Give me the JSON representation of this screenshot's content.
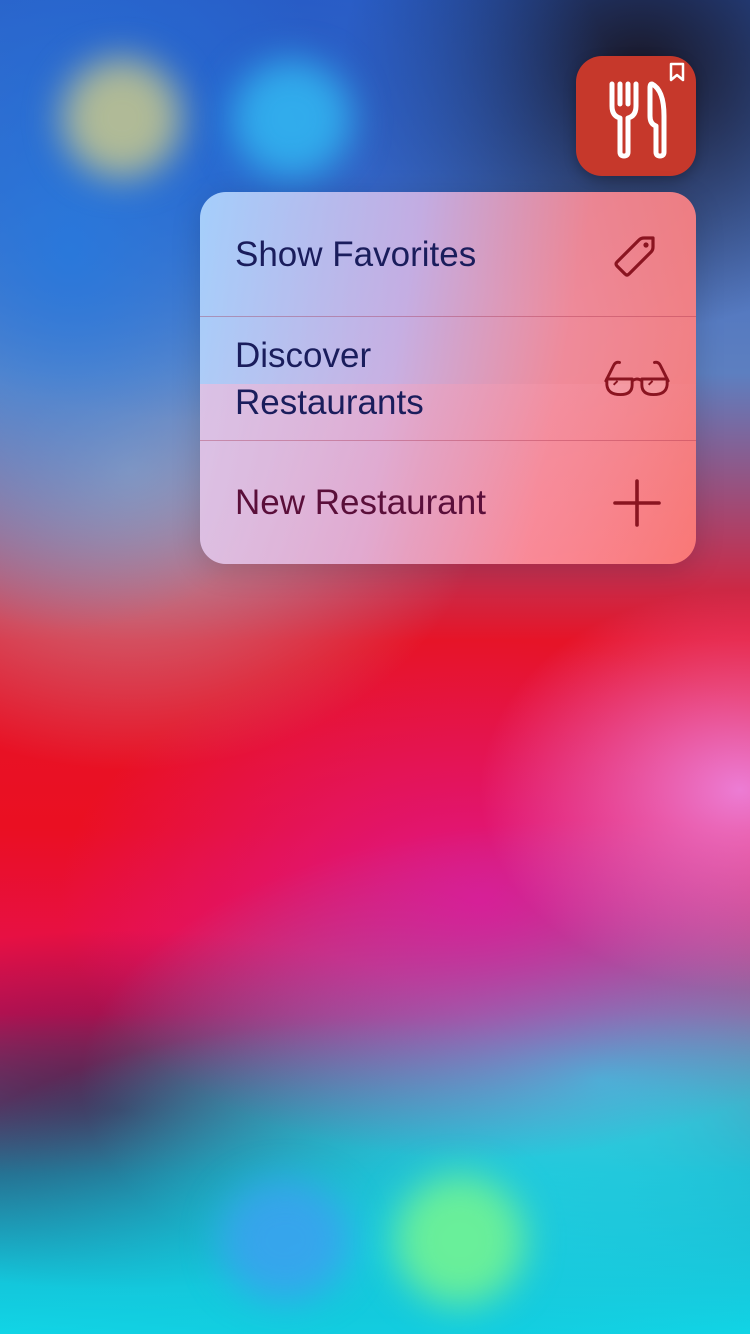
{
  "app": {
    "name": "Restaurant app",
    "icon": "fork-knife-icon",
    "badge_icon": "bookmark-icon",
    "icon_color": "#c6382b"
  },
  "quick_actions": [
    {
      "label": "Show Favorites",
      "icon": "tag-icon"
    },
    {
      "label": "Discover\nRestaurants",
      "icon": "glasses-icon"
    },
    {
      "label": "New Restaurant",
      "icon": "plus-icon"
    }
  ],
  "colors": {
    "label_text": "#1a1d5c",
    "icon_stroke": "#8a1420"
  }
}
